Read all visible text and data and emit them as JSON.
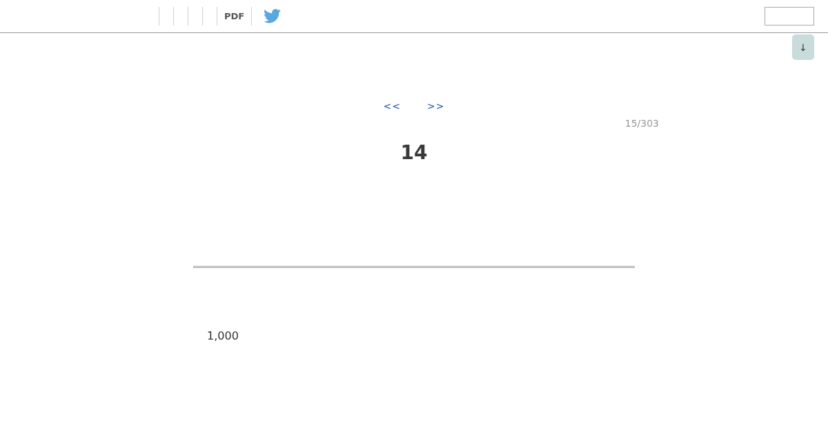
{
  "toolbar": {
    "pdf_link": "PDF"
  },
  "scroll_button": {
    "label": "↓"
  },
  "nav": {
    "prev": "<<",
    "next": ">>"
  },
  "page_counter": "15/303",
  "heading": "14",
  "amount": "1,000"
}
